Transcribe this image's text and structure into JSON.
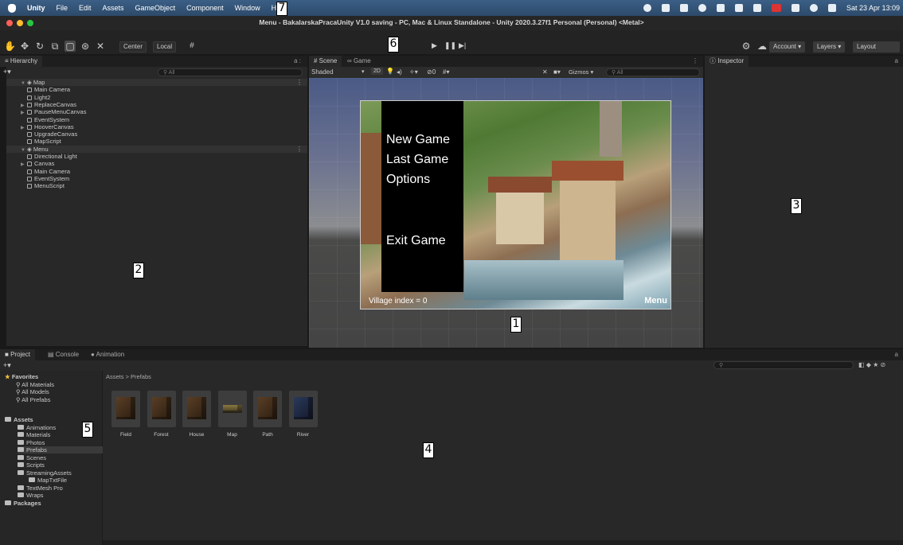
{
  "menubar": {
    "app": "Unity",
    "items": [
      "File",
      "Edit",
      "Assets",
      "GameObject",
      "Component",
      "Window",
      "Help"
    ],
    "datetime": "Sat 23 Apr 13:09"
  },
  "titlebar": {
    "title": "Menu - BakalarskaPracaUnity V1.0 saving - PC, Mac & Linux Standalone - Unity 2020.3.27f1 Personal (Personal) <Metal>"
  },
  "toolbar": {
    "pivot": "Center",
    "space": "Local",
    "account": "Account",
    "layers": "Layers",
    "layout": "Layout"
  },
  "hierarchy": {
    "tab": "Hierarchy",
    "search_placeholder": "All",
    "rows": [
      {
        "label": "Map",
        "scene": true
      },
      {
        "label": "Main Camera"
      },
      {
        "label": "Light2"
      },
      {
        "label": "ReplaceCanvas",
        "expand": true
      },
      {
        "label": "PauseMenuCanvas",
        "expand": true
      },
      {
        "label": "EventSystem"
      },
      {
        "label": "HooverCanvas",
        "expand": true
      },
      {
        "label": "UpgradeCanvas"
      },
      {
        "label": "MapScript"
      },
      {
        "label": "Menu",
        "scene": true
      },
      {
        "label": "Directional Light"
      },
      {
        "label": "Canvas",
        "expand": true
      },
      {
        "label": "Main Camera"
      },
      {
        "label": "EventSystem"
      },
      {
        "label": "MenuScript"
      }
    ]
  },
  "scene": {
    "tab_scene": "Scene",
    "tab_game": "Game",
    "shading": "Shaded",
    "mode2d": "2D",
    "hidden_count": "0",
    "gizmos": "Gizmos",
    "search_placeholder": "All",
    "menu_items": [
      "New Game",
      "Last Game",
      "Options",
      "Exit Game"
    ],
    "village_index": "Village index = 0",
    "menu_label": "Menu"
  },
  "inspector": {
    "tab": "Inspector"
  },
  "project": {
    "tabs": [
      "Project",
      "Console",
      "Animation"
    ],
    "favorites_label": "Favorites",
    "favorites": [
      "All Materials",
      "All Models",
      "All Prefabs"
    ],
    "assets_label": "Assets",
    "folders": [
      "Animations",
      "Materials",
      "Photos",
      "Prefabs",
      "Scenes",
      "Scripts",
      "StreamingAssets",
      "MapTxtFile",
      "TextMesh Pro",
      "Wraps"
    ],
    "packages_label": "Packages",
    "breadcrumb": "Assets > Prefabs",
    "prefabs": [
      "Field",
      "Forest",
      "House",
      "Map",
      "Path",
      "River"
    ]
  },
  "markers": [
    "1",
    "2",
    "3",
    "4",
    "5",
    "6",
    "7"
  ],
  "colors": {
    "menubar": "#2d4a6a",
    "panel": "#282828",
    "selected": "#3a3a3a"
  }
}
